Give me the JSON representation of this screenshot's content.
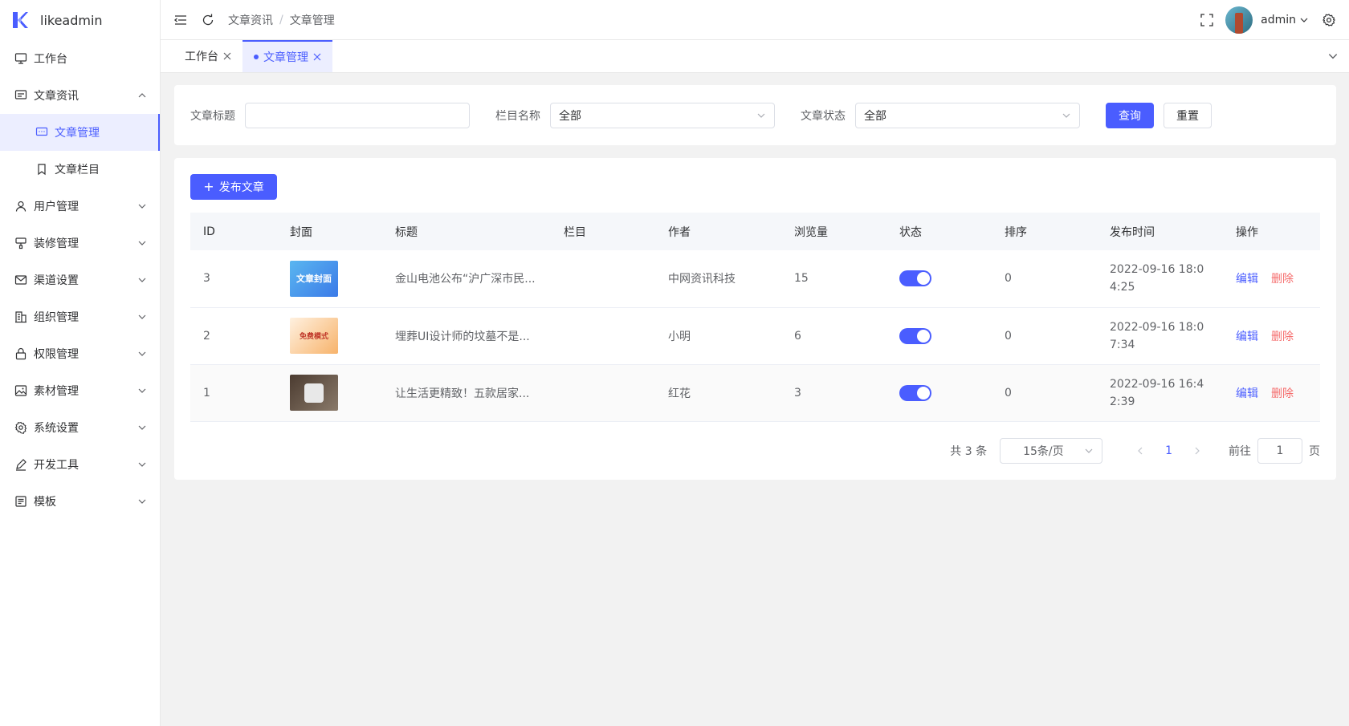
{
  "app": {
    "name": "likeadmin"
  },
  "sidebar": {
    "items": [
      {
        "label": "工作台",
        "icon": "monitor-icon",
        "expandable": false
      },
      {
        "label": "文章资讯",
        "icon": "chat-icon",
        "expandable": true,
        "expanded": true
      },
      {
        "label": "文章管理",
        "icon": "message-icon",
        "sub": true,
        "active": true
      },
      {
        "label": "文章栏目",
        "icon": "bookmark-icon",
        "sub": true
      },
      {
        "label": "用户管理",
        "icon": "user-icon",
        "expandable": true
      },
      {
        "label": "装修管理",
        "icon": "brush-icon",
        "expandable": true
      },
      {
        "label": "渠道设置",
        "icon": "mail-icon",
        "expandable": true
      },
      {
        "label": "组织管理",
        "icon": "building-icon",
        "expandable": true
      },
      {
        "label": "权限管理",
        "icon": "lock-icon",
        "expandable": true
      },
      {
        "label": "素材管理",
        "icon": "picture-icon",
        "expandable": true
      },
      {
        "label": "系统设置",
        "icon": "gear-icon",
        "expandable": true
      },
      {
        "label": "开发工具",
        "icon": "pen-icon",
        "expandable": true
      },
      {
        "label": "模板",
        "icon": "template-icon",
        "expandable": true
      }
    ]
  },
  "header": {
    "breadcrumb": [
      "文章资讯",
      "文章管理"
    ],
    "breadcrumb_sep": "/",
    "username": "admin"
  },
  "tabs": [
    {
      "label": "工作台",
      "active": false
    },
    {
      "label": "文章管理",
      "active": true
    }
  ],
  "filter": {
    "title_label": "文章标题",
    "title_value": "",
    "category_label": "栏目名称",
    "category_value": "全部",
    "status_label": "文章状态",
    "status_value": "全部",
    "search_label": "查询",
    "reset_label": "重置"
  },
  "toolbar": {
    "add_label": "发布文章",
    "add_plus": "+"
  },
  "table": {
    "columns": [
      "ID",
      "封面",
      "标题",
      "栏目",
      "作者",
      "浏览量",
      "状态",
      "排序",
      "发布时间",
      "操作"
    ],
    "rows": [
      {
        "id": "3",
        "cover_text": "文章封面",
        "title": "金山电池公布“沪广深市民...",
        "category": "",
        "author": "中网资讯科技",
        "views": "15",
        "status": true,
        "sort": "0",
        "time": "2022-09-16 18:04:25"
      },
      {
        "id": "2",
        "cover_text": "免费模式",
        "title": "埋葬UI设计师的坟墓不是...",
        "category": "",
        "author": "小明",
        "views": "6",
        "status": true,
        "sort": "0",
        "time": "2022-09-16 18:07:34"
      },
      {
        "id": "1",
        "cover_text": "",
        "title": "让生活更精致！五款居家...",
        "category": "",
        "author": "红花",
        "views": "3",
        "status": true,
        "sort": "0",
        "time": "2022-09-16 16:42:39"
      }
    ],
    "edit_label": "编辑",
    "delete_label": "删除"
  },
  "pagination": {
    "total_text": "共 3 条",
    "page_size": "15条/页",
    "current_page": "1",
    "goto_label": "前往",
    "goto_value": "1",
    "page_suffix": "页"
  },
  "colors": {
    "primary": "#4a5dff",
    "danger": "#f56c6c",
    "background": "#f2f2f2"
  }
}
